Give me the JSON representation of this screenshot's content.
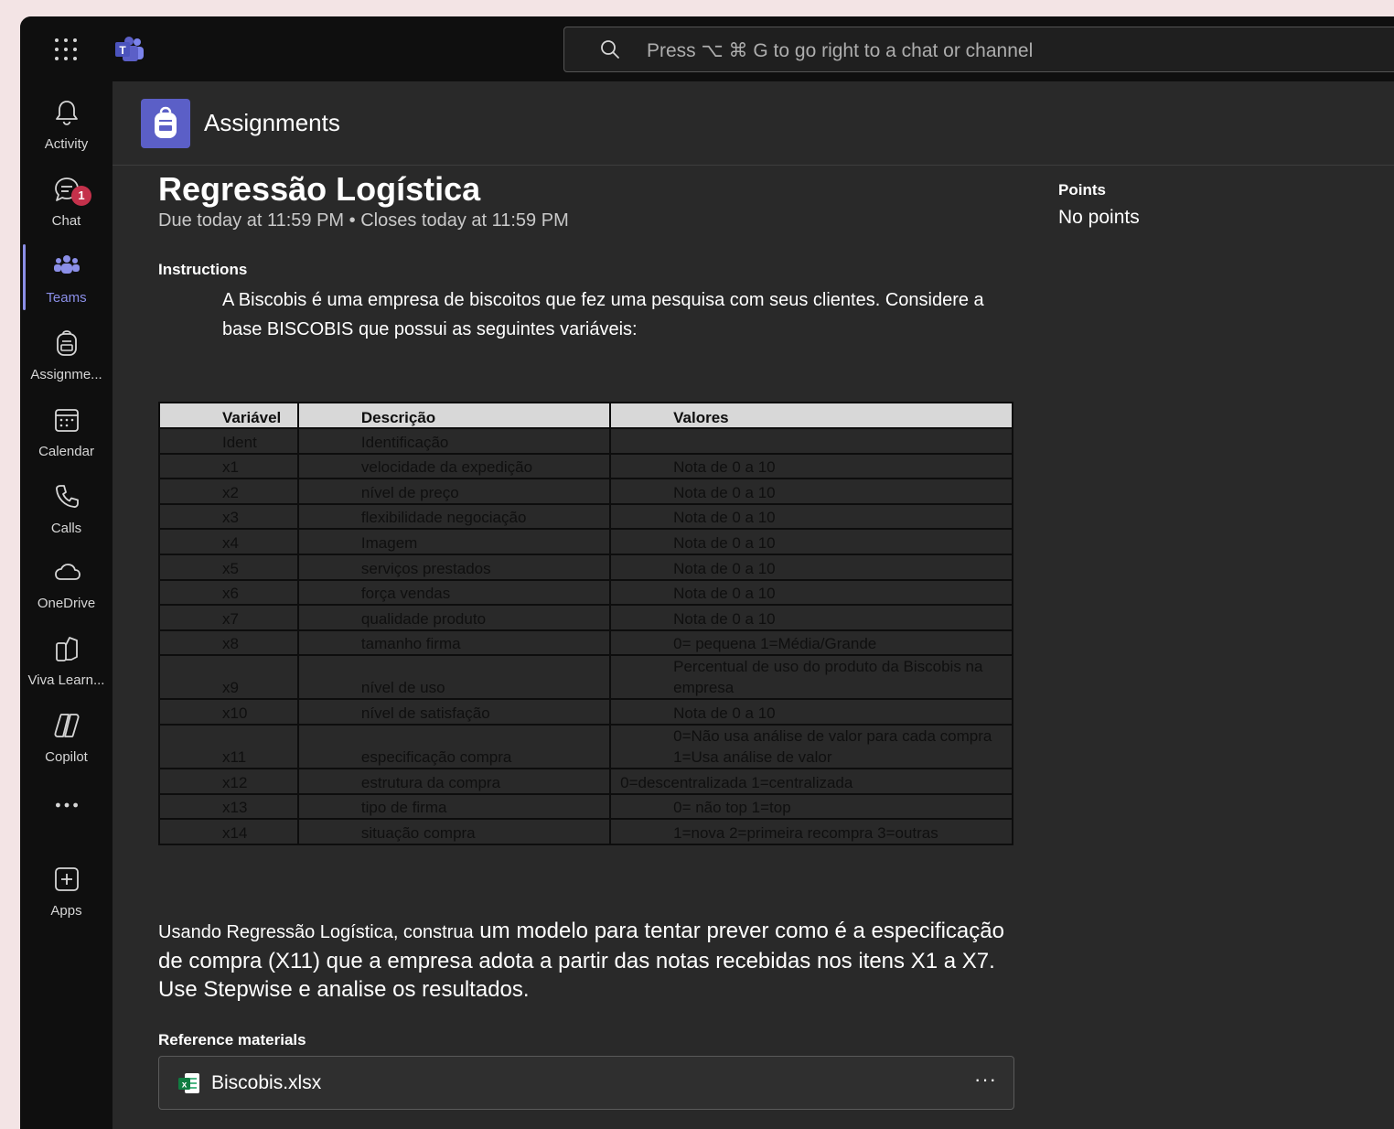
{
  "topbar": {
    "search_placeholder": "Press ⌥ ⌘ G to go right to a chat or channel"
  },
  "rail": {
    "items": [
      {
        "label": "Activity",
        "icon": "bell-icon"
      },
      {
        "label": "Chat",
        "icon": "chat-icon",
        "badge": "1"
      },
      {
        "label": "Teams",
        "icon": "teams-icon"
      },
      {
        "label": "Assignme...",
        "icon": "backpack-icon"
      },
      {
        "label": "Calendar",
        "icon": "calendar-icon"
      },
      {
        "label": "Calls",
        "icon": "phone-icon"
      },
      {
        "label": "OneDrive",
        "icon": "cloud-icon"
      },
      {
        "label": "Viva Learn...",
        "icon": "book-icon"
      },
      {
        "label": "Copilot",
        "icon": "copilot-icon"
      },
      {
        "label": "•••",
        "icon": "more-icon"
      },
      {
        "label": "Apps",
        "icon": "add-apps-icon"
      }
    ],
    "active": "Teams"
  },
  "header": {
    "title": "Assignments"
  },
  "assignment": {
    "title": "Regressão Logística",
    "due": "Due today at 11:59 PM • Closes today at 11:59 PM",
    "points_label": "Points",
    "points_value": "No points",
    "instructions_label": "Instructions",
    "intro": "A Biscobis é uma empresa de biscoitos que fez uma pesquisa com seus clientes. Considere a base BISCOBIS que possui as seguintes variáveis:",
    "closing_part1": "Usando Regressão Logística,  construa",
    "closing_part2": " um modelo para tentar prever como é a especificação de compra (X11) que a empresa adota a partir das notas recebidas nos itens X1 a X7. Use Stepwise e analise os resultados.",
    "reference_label": "Reference materials",
    "file_name": "Biscobis.xlsx",
    "file_more": "···"
  },
  "table": {
    "headers": [
      "Variável",
      "Descrição",
      "Valores"
    ],
    "rows": [
      [
        "Ident",
        "Identificação",
        ""
      ],
      [
        "x1",
        "velocidade da expedição",
        "Nota de 0 a 10"
      ],
      [
        "x2",
        "nível de preço",
        "Nota de 0 a 10"
      ],
      [
        "x3",
        "flexibilidade negociação",
        "Nota de 0 a 10"
      ],
      [
        "x4",
        "Imagem",
        "Nota de 0 a 10"
      ],
      [
        "x5",
        "serviços prestados",
        "Nota de 0 a 10"
      ],
      [
        "x6",
        "força vendas",
        "Nota de 0 a 10"
      ],
      [
        "x7",
        "qualidade produto",
        "Nota de 0 a 10"
      ],
      [
        "x8",
        "tamanho firma",
        "0= pequena 1=Média/Grande"
      ],
      [
        "x9",
        "nível de uso",
        "Percentual de uso do produto da Biscobis na empresa"
      ],
      [
        "x10",
        "nível de satisfação",
        "Nota de 0 a 10"
      ],
      [
        "x11",
        "especificação compra",
        "0=Não usa análise de valor para cada compra 1=Usa análise de valor"
      ],
      [
        "x12",
        "estrutura da compra",
        "0=descentralizada 1=centralizada"
      ],
      [
        "x13",
        "tipo de firma",
        "0= não top 1=top"
      ],
      [
        "x14",
        "situação compra",
        "1=nova 2=primeira recompra 3=outras"
      ]
    ]
  },
  "colors": {
    "accent": "#5b5fc7",
    "active_rail": "#8b8fe8",
    "badge": "#c4314b",
    "background": "#292929"
  }
}
